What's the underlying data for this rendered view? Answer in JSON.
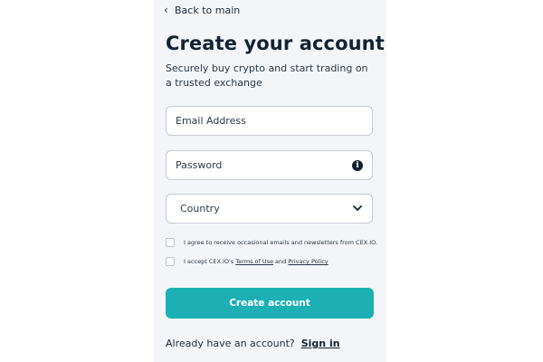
{
  "nav": {
    "back_label": "Back to main"
  },
  "header": {
    "title": "Create your account",
    "subtitle": "Securely buy crypto and start trading on a trusted exchange"
  },
  "form": {
    "email_placeholder": "Email Address",
    "password_placeholder": "Password",
    "country_placeholder": "Country",
    "consent_newsletter": "I agree to receive occasional emails and newsletters from CEX.IO.",
    "consent_terms_prefix": "I accept CEX.IO's ",
    "terms_link": "Terms of Use",
    "consent_terms_and": " and ",
    "privacy_link": "Privacy Policy",
    "submit_label": "Create account"
  },
  "footer": {
    "have_account_text": "Already have an account? ",
    "signin_label": "Sign in"
  },
  "colors": {
    "accent": "#1cb0b4",
    "panel_bg": "#f3f5f8",
    "text_dark": "#152233"
  },
  "icons": {
    "back": "chevron-left-icon",
    "password_info": "info-icon",
    "country_dropdown": "chevron-down-icon"
  }
}
